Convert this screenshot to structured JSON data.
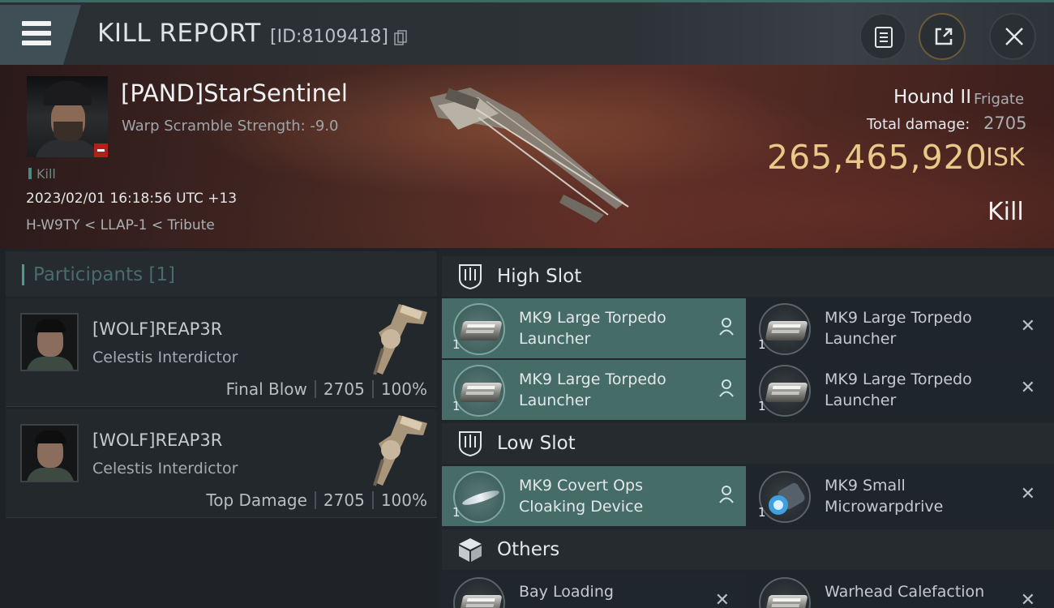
{
  "titlebar": {
    "title": "KILL REPORT",
    "id_text": "[ID:8109418]"
  },
  "victim": {
    "name": "[PAND]StarSentinel",
    "scramble": "Warp Scramble Strength: -9.0",
    "kill_tag": "Kill",
    "datetime": "2023/02/01 16:18:56 UTC +13",
    "location": "H-W9TY < LLAP-1 < Tribute",
    "ship_name": "Hound II",
    "ship_class": "Frigate",
    "total_damage_label": "Total damage:",
    "total_damage": "2705",
    "isk_value": "265,465,920",
    "isk_unit": "ISK",
    "result": "Kill"
  },
  "participants": {
    "title": "Participants [1]",
    "items": [
      {
        "name": "[WOLF]REAP3R",
        "ship": "Celestis Interdictor",
        "role": "Final Blow",
        "damage": "2705",
        "percent": "100%"
      },
      {
        "name": "[WOLF]REAP3R",
        "ship": "Celestis Interdictor",
        "role": "Top Damage",
        "damage": "2705",
        "percent": "100%"
      }
    ]
  },
  "fittings": {
    "high_slot": {
      "label": "High Slot",
      "items": [
        {
          "qty": "1",
          "line1": "MK9 Large Torpedo",
          "line2": "Launcher"
        },
        {
          "qty": "1",
          "line1": "MK9 Large Torpedo",
          "line2": "Launcher"
        },
        {
          "qty": "1",
          "line1": "MK9 Large Torpedo",
          "line2": "Launcher"
        },
        {
          "qty": "1",
          "line1": "MK9 Large Torpedo",
          "line2": "Launcher"
        }
      ]
    },
    "low_slot": {
      "label": "Low Slot",
      "items": [
        {
          "qty": "1",
          "line1": "MK9 Covert Ops",
          "line2": "Cloaking Device"
        },
        {
          "qty": "1",
          "line1": "MK9 Small",
          "line2": "Microwarpdrive"
        }
      ]
    },
    "others": {
      "label": "Others",
      "items": [
        {
          "line1": "Bay Loading"
        },
        {
          "line1": "Warhead Calefaction"
        }
      ]
    }
  },
  "colors": {
    "accent_teal": "#466c68",
    "isk_gold": "#e8c987",
    "badge_red": "#b3201b"
  }
}
